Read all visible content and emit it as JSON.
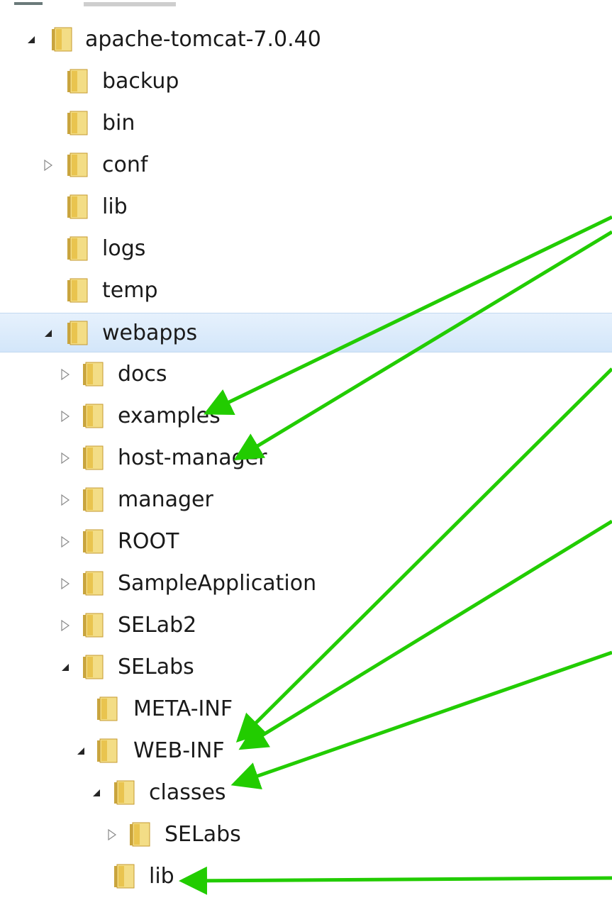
{
  "tree": {
    "rows": [
      {
        "label": "apache-tomcat-7.0.40",
        "expander": "expanded"
      },
      {
        "label": "backup",
        "expander": "none"
      },
      {
        "label": "bin",
        "expander": "none"
      },
      {
        "label": "conf",
        "expander": "collapsed"
      },
      {
        "label": "lib",
        "expander": "none"
      },
      {
        "label": "logs",
        "expander": "none"
      },
      {
        "label": "temp",
        "expander": "none"
      },
      {
        "label": "webapps",
        "expander": "expanded",
        "selected": true
      },
      {
        "label": "docs",
        "expander": "collapsed"
      },
      {
        "label": "examples",
        "expander": "collapsed"
      },
      {
        "label": "host-manager",
        "expander": "collapsed"
      },
      {
        "label": "manager",
        "expander": "collapsed"
      },
      {
        "label": "ROOT",
        "expander": "collapsed"
      },
      {
        "label": "SampleApplication",
        "expander": "collapsed"
      },
      {
        "label": "SELab2",
        "expander": "collapsed"
      },
      {
        "label": "SELabs",
        "expander": "expanded"
      },
      {
        "label": "META-INF",
        "expander": "none"
      },
      {
        "label": "WEB-INF",
        "expander": "expanded"
      },
      {
        "label": "classes",
        "expander": "expanded"
      },
      {
        "label": "SELabs",
        "expander": "collapsed"
      },
      {
        "label": "lib",
        "expander": "none"
      }
    ]
  },
  "colors": {
    "arrow": "#22cc00",
    "selection": "#d9eafb",
    "folder": "#e8c65a"
  },
  "icons": {
    "folder": "folder-icon",
    "expanded": "triangle-expanded-icon",
    "collapsed": "triangle-collapsed-icon",
    "arrow": "green-arrow-annotation"
  }
}
